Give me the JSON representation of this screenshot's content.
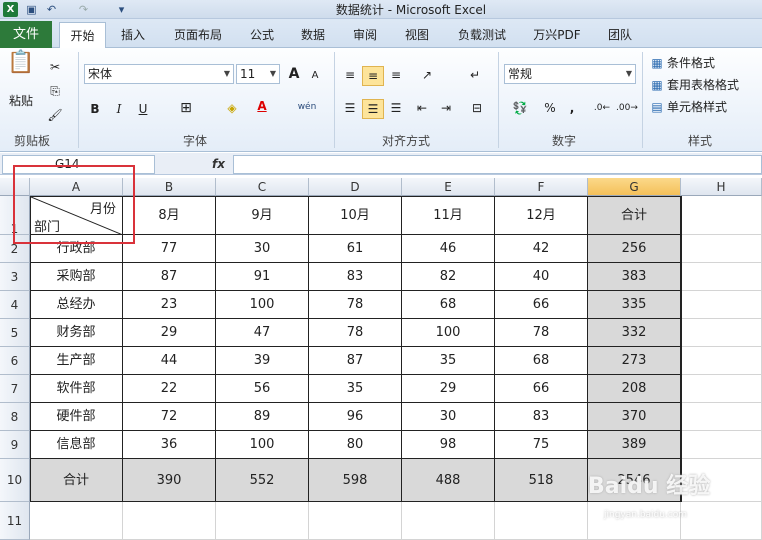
{
  "window": {
    "title": "数据统计 - Microsoft Excel",
    "app_icon": "excel-icon"
  },
  "quick_access": [
    "save-icon",
    "undo-icon",
    "redo-icon",
    "customize-icon"
  ],
  "ribbon_tabs": [
    "文件",
    "开始",
    "插入",
    "页面布局",
    "公式",
    "数据",
    "审阅",
    "视图",
    "负载测试",
    "万兴PDF",
    "团队"
  ],
  "active_tab": "开始",
  "clipboard": {
    "paste": "粘贴",
    "label": "剪贴板"
  },
  "font": {
    "name": "宋体",
    "size": "11",
    "bold": "B",
    "italic": "I",
    "underline": "U",
    "grow": "A",
    "shrink": "A",
    "label": "字体",
    "phonetic": "wén"
  },
  "alignment": {
    "label": "对齐方式"
  },
  "number": {
    "format": "常规",
    "percent": "%",
    "comma": ",",
    "label": "数字"
  },
  "styles": {
    "conditional": "条件格式",
    "table": "套用表格格式",
    "cell": "单元格样式",
    "label": "样式"
  },
  "formula_bar": {
    "name_box": "G14",
    "fx": "fx",
    "value": ""
  },
  "columns": [
    "A",
    "B",
    "C",
    "D",
    "E",
    "F",
    "G",
    "H"
  ],
  "rows": [
    "1",
    "2",
    "3",
    "4",
    "5",
    "6",
    "7",
    "8",
    "9",
    "10",
    "11"
  ],
  "header_cell": {
    "top": "月份",
    "bottom": "部门"
  },
  "months": [
    "8月",
    "9月",
    "10月",
    "11月",
    "12月",
    "合计"
  ],
  "table": [
    {
      "dept": "行政部",
      "values": [
        "77",
        "30",
        "61",
        "46",
        "42",
        "256"
      ]
    },
    {
      "dept": "采购部",
      "values": [
        "87",
        "91",
        "83",
        "82",
        "40",
        "383"
      ]
    },
    {
      "dept": "总经办",
      "values": [
        "23",
        "100",
        "78",
        "68",
        "66",
        "335"
      ]
    },
    {
      "dept": "财务部",
      "values": [
        "29",
        "47",
        "78",
        "100",
        "78",
        "332"
      ]
    },
    {
      "dept": "生产部",
      "values": [
        "44",
        "39",
        "87",
        "35",
        "68",
        "273"
      ]
    },
    {
      "dept": "软件部",
      "values": [
        "22",
        "56",
        "35",
        "29",
        "66",
        "208"
      ]
    },
    {
      "dept": "硬件部",
      "values": [
        "72",
        "89",
        "96",
        "30",
        "83",
        "370"
      ]
    },
    {
      "dept": "信息部",
      "values": [
        "36",
        "100",
        "80",
        "98",
        "75",
        "389"
      ]
    }
  ],
  "total_row": {
    "label": "合计",
    "values": [
      "390",
      "552",
      "598",
      "488",
      "518",
      "2546"
    ]
  },
  "watermark": {
    "main": "Baidu 经验",
    "sub": "jingyan.baidu.com"
  },
  "colors": {
    "file_tab": "#2d7a3a",
    "highlight": "#d9d9d9",
    "selected_col": "#f4c05a",
    "annotation": "#d9323a"
  }
}
